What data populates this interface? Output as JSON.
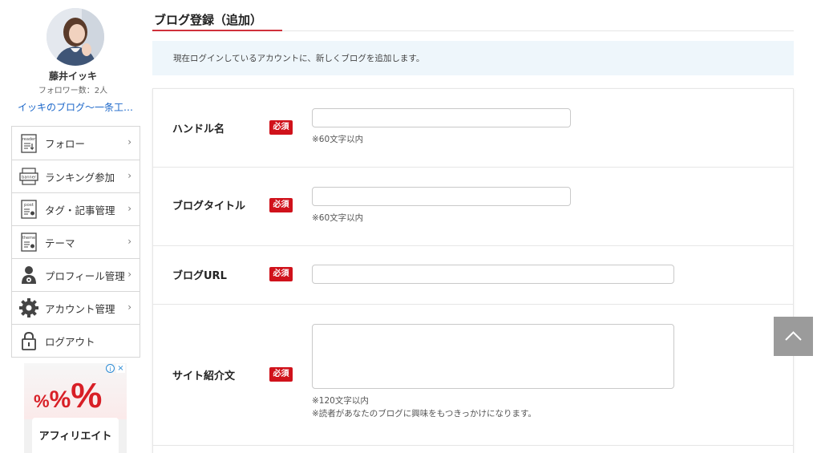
{
  "profile": {
    "name": "藤井イッキ",
    "followers": "フォロワー数：2人",
    "blog_link": "イッキのブログ〜一条工…"
  },
  "sidebar": {
    "items": [
      {
        "label": "フォロー",
        "icon": "reader-icon",
        "chevron": "›"
      },
      {
        "label": "ランキング参加",
        "icon": "banner-icon",
        "chevron": "›"
      },
      {
        "label": "タグ・記事管理",
        "icon": "post-icon",
        "chevron": "›"
      },
      {
        "label": "テーマ",
        "icon": "theme-icon",
        "chevron": "›"
      },
      {
        "label": "プロフィール管理",
        "icon": "person-icon",
        "chevron": "›"
      },
      {
        "label": "アカウント管理",
        "icon": "gear-icon",
        "chevron": "›"
      },
      {
        "label": "ログアウト",
        "icon": "lock-icon",
        "chevron": ""
      }
    ],
    "icon_texts": {
      "reader": "reader",
      "banner": "banner",
      "post": "post",
      "theme": "theme"
    }
  },
  "ad": {
    "headline": "%%%",
    "text": "アフィリエイト",
    "info": "i",
    "close": "×"
  },
  "main": {
    "title": "ブログ登録（追加）",
    "notice": "現在ログインしているアカウントに、新しくブログを追加します。",
    "required_label": "必須",
    "fields": [
      {
        "label": "ハンドル名",
        "value": "",
        "notes": [
          "※60文字以内"
        ]
      },
      {
        "label": "ブログタイトル",
        "value": "",
        "notes": [
          "※60文字以内"
        ]
      },
      {
        "label": "ブログURL",
        "value": "",
        "notes": []
      },
      {
        "label": "サイト紹介文",
        "value": "",
        "notes": [
          "※120文字以内",
          "※読者があなたのブログに興味をもつきっかけになります。"
        ]
      }
    ]
  },
  "colors": {
    "accent": "#d0313b",
    "required_badge": "#d0121b",
    "link": "#1a66c9",
    "notice_bg": "#eef6fb",
    "back_to_top": "#9b9b9b"
  },
  "back_to_top": {
    "icon": "chevron-up-icon"
  }
}
